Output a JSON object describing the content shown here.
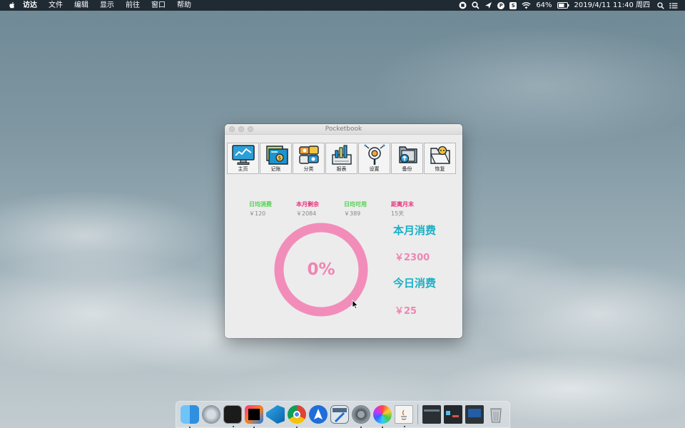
{
  "menubar": {
    "items": [
      "访达",
      "文件",
      "编辑",
      "显示",
      "前往",
      "窗口",
      "帮助"
    ],
    "status_icons": [
      "stop-icon",
      "search-key-icon",
      "send-icon",
      "p-icon",
      "s-icon",
      "wifi-icon"
    ],
    "battery": "64%",
    "datetime": "2019/4/11 11:40 周四",
    "p_letter": "P",
    "s_letter": "S"
  },
  "window": {
    "title": "Pocketbook",
    "toolbar": [
      {
        "label": "主页",
        "icon": "monitor-chart-icon"
      },
      {
        "label": "记账",
        "icon": "ledger-coin-icon"
      },
      {
        "label": "分类",
        "icon": "currency-exchange-icon"
      },
      {
        "label": "报表",
        "icon": "bar-report-icon"
      },
      {
        "label": "设置",
        "icon": "magnifier-settings-icon"
      },
      {
        "label": "备份",
        "icon": "folder-upload-icon"
      },
      {
        "label": "恢复",
        "icon": "folder-restore-icon"
      }
    ],
    "stats": [
      {
        "label": "日均消费",
        "value": "￥120"
      },
      {
        "label": "本月剩余",
        "value": "￥2084"
      },
      {
        "label": "日均可用",
        "value": "￥389"
      },
      {
        "label": "距离月末",
        "value": "15天"
      }
    ],
    "progress": {
      "text": "0%",
      "value": 0
    },
    "month_label": "本月消费",
    "month_amount": "￥2300",
    "today_label": "今日消费",
    "today_amount": "￥25"
  },
  "colors": {
    "accent_pink": "#ef85b3",
    "accent_teal": "#1ab0c6",
    "green": "#4bd24b",
    "magenta": "#e8307a"
  },
  "dock": {
    "apps": [
      "finder-icon",
      "launchpad-icon",
      "terminal-icon",
      "intellij-icon",
      "vscode-icon",
      "chrome-icon",
      "maps-icon",
      "chm-viewer-icon",
      "system-preferences-icon",
      "color-picker-icon",
      "java-file-icon",
      "window-thumbnail-1",
      "window-thumbnail-2",
      "window-thumbnail-3",
      "trash-icon"
    ]
  }
}
